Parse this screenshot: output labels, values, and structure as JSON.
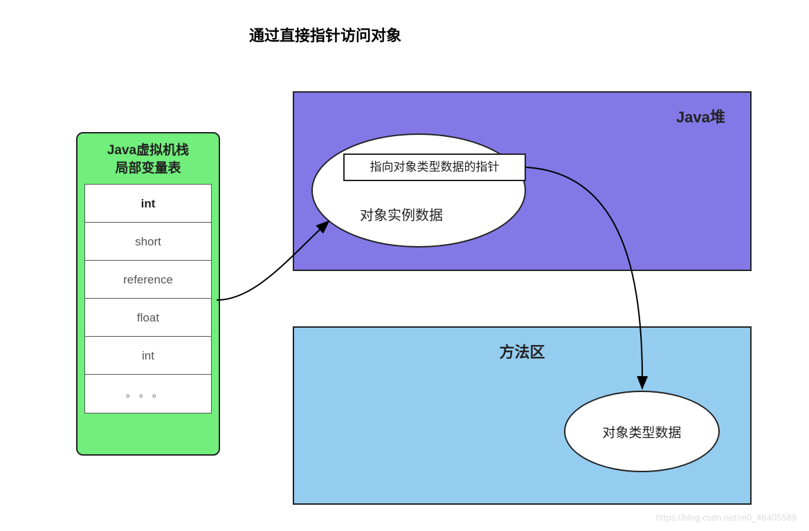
{
  "title": "通过直接指针访问对象",
  "stack": {
    "header_line1": "Java虚拟机栈",
    "header_line2": "局部变量表",
    "cells": [
      "int",
      "short",
      "reference",
      "float",
      "int",
      "。。。"
    ]
  },
  "heap": {
    "title": "Java堆",
    "pointer_label": "指向对象类型数据的指针",
    "instance_label": "对象实例数据"
  },
  "method_area": {
    "title": "方法区",
    "type_data_label": "对象类型数据"
  },
  "watermark": "https://blog.csdn.net/m0_46405589"
}
